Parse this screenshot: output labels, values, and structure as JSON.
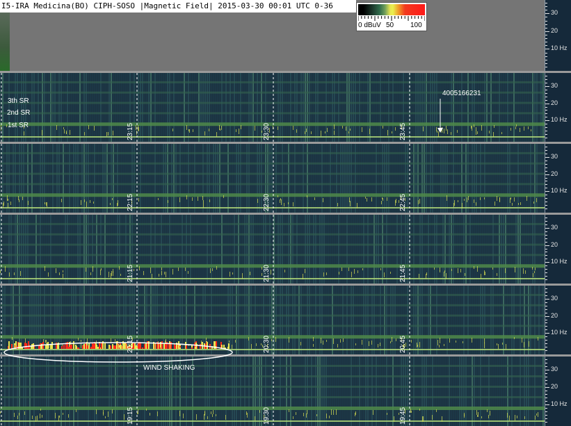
{
  "title": "I5-IRA Medicina(BO) CIPH-SOSO |Magnetic Field| 2015-03-30 00:01 UTC 0-36",
  "legend": {
    "labels": [
      "0 dBuV",
      "50",
      "100"
    ],
    "colors": [
      "#000000",
      "#2f6b4a",
      "#e8e650",
      "#f23a1e"
    ]
  },
  "chart_data": {
    "type": "heatmap",
    "title": "I5-IRA Medicina(BO) CIPH-SOSO |Magnetic Field| 2015-03-30 00:01 UTC 0-36",
    "xlabel": "",
    "ylabel": "",
    "ylim": [
      0,
      36
    ],
    "y_ticks": [
      10,
      20,
      30
    ],
    "y_tick_labels": [
      "10 Hz",
      "20",
      "30"
    ],
    "colorbar": {
      "min": 0,
      "max": 100,
      "labels": [
        "0 dBuV",
        "50",
        "100"
      ]
    },
    "rows": [
      {
        "time_labels": [
          "23:15",
          "23:30",
          "23:45"
        ]
      },
      {
        "time_labels": [
          "22:15",
          "22:30",
          "22:45"
        ]
      },
      {
        "time_labels": [
          "21:15",
          "21:30",
          "21:45"
        ]
      },
      {
        "time_labels": [
          "20:15",
          "20:30",
          "20:45"
        ]
      },
      {
        "time_labels": [
          "19:15",
          "19:30",
          "19:45"
        ]
      }
    ],
    "annotations": [
      "3th SR",
      "2nd SR",
      "1st SR",
      "4005166231",
      "WIND SHAKING"
    ]
  },
  "annotations": {
    "sr3": "3th SR",
    "sr2": "2nd SR",
    "sr1": "1st SR",
    "id": "4005166231",
    "wind": "WIND SHAKING"
  }
}
